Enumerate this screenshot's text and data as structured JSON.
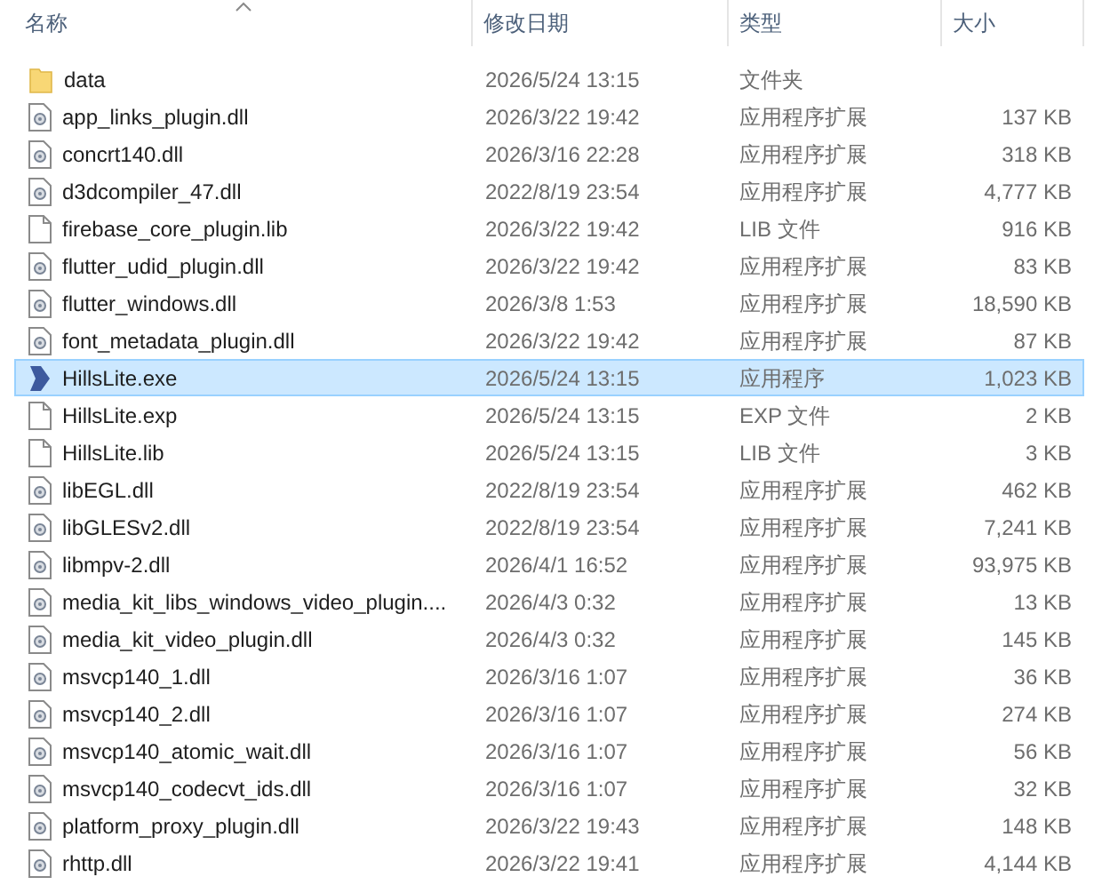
{
  "columns": [
    {
      "label": "名称",
      "sorted": true
    },
    {
      "label": "修改日期",
      "sorted": false
    },
    {
      "label": "类型",
      "sorted": false
    },
    {
      "label": "大小",
      "sorted": false
    }
  ],
  "rows": [
    {
      "kind": "folder",
      "name": "data",
      "date": "2026/5/24 13:15",
      "type": "文件夹",
      "selected": false
    },
    {
      "kind": "dll",
      "name": "app_links_plugin.dll",
      "date": "2026/3/22 19:42",
      "type": "应用程序扩展",
      "size": "137 KB",
      "selected": false
    },
    {
      "kind": "dll",
      "name": "concrt140.dll",
      "date": "2026/3/16 22:28",
      "type": "应用程序扩展",
      "size": "318 KB",
      "selected": false
    },
    {
      "kind": "dll",
      "name": "d3dcompiler_47.dll",
      "date": "2022/8/19 23:54",
      "type": "应用程序扩展",
      "size": "4,777 KB",
      "selected": false
    },
    {
      "kind": "file",
      "name": "firebase_core_plugin.lib",
      "date": "2026/3/22 19:42",
      "type": "LIB 文件",
      "size": "916 KB",
      "selected": false
    },
    {
      "kind": "dll",
      "name": "flutter_udid_plugin.dll",
      "date": "2026/3/22 19:42",
      "type": "应用程序扩展",
      "size": "83 KB",
      "selected": false
    },
    {
      "kind": "dll",
      "name": "flutter_windows.dll",
      "date": "2026/3/8 1:53",
      "type": "应用程序扩展",
      "size": "18,590 KB",
      "selected": false
    },
    {
      "kind": "dll",
      "name": "font_metadata_plugin.dll",
      "date": "2026/3/22 19:42",
      "type": "应用程序扩展",
      "size": "87 KB",
      "selected": false
    },
    {
      "kind": "exe",
      "name": "HillsLite.exe",
      "date": "2026/5/24 13:15",
      "type": "应用程序",
      "size": "1,023 KB",
      "selected": true
    },
    {
      "kind": "file",
      "name": "HillsLite.exp",
      "date": "2026/5/24 13:15",
      "type": "EXP 文件",
      "size": "2 KB",
      "selected": false
    },
    {
      "kind": "file",
      "name": "HillsLite.lib",
      "date": "2026/5/24 13:15",
      "type": "LIB 文件",
      "size": "3 KB",
      "selected": false
    },
    {
      "kind": "dll",
      "name": "libEGL.dll",
      "date": "2022/8/19 23:54",
      "type": "应用程序扩展",
      "size": "462 KB",
      "selected": false
    },
    {
      "kind": "dll",
      "name": "libGLESv2.dll",
      "date": "2022/8/19 23:54",
      "type": "应用程序扩展",
      "size": "7,241 KB",
      "selected": false
    },
    {
      "kind": "dll",
      "name": "libmpv-2.dll",
      "date": "2026/4/1 16:52",
      "type": "应用程序扩展",
      "size": "93,975 KB",
      "selected": false
    },
    {
      "kind": "dll",
      "name": "media_kit_libs_windows_video_plugin....",
      "date": "2026/4/3 0:32",
      "type": "应用程序扩展",
      "size": "13 KB",
      "selected": false
    },
    {
      "kind": "dll",
      "name": "media_kit_video_plugin.dll",
      "date": "2026/4/3 0:32",
      "type": "应用程序扩展",
      "size": "145 KB",
      "selected": false
    },
    {
      "kind": "dll",
      "name": "msvcp140_1.dll",
      "date": "2026/3/16 1:07",
      "type": "应用程序扩展",
      "size": "36 KB",
      "selected": false
    },
    {
      "kind": "dll",
      "name": "msvcp140_2.dll",
      "date": "2026/3/16 1:07",
      "type": "应用程序扩展",
      "size": "274 KB",
      "selected": false
    },
    {
      "kind": "dll",
      "name": "msvcp140_atomic_wait.dll",
      "date": "2026/3/16 1:07",
      "type": "应用程序扩展",
      "size": "56 KB",
      "selected": false
    },
    {
      "kind": "dll",
      "name": "msvcp140_codecvt_ids.dll",
      "date": "2026/3/16 1:07",
      "type": "应用程序扩展",
      "size": "32 KB",
      "selected": false
    },
    {
      "kind": "dll",
      "name": "platform_proxy_plugin.dll",
      "date": "2026/3/22 19:43",
      "type": "应用程序扩展",
      "size": "148 KB",
      "selected": false
    },
    {
      "kind": "dll",
      "name": "rhttp.dll",
      "date": "2026/3/22 19:41",
      "type": "应用程序扩展",
      "size": "4,144 KB",
      "selected": false
    }
  ]
}
